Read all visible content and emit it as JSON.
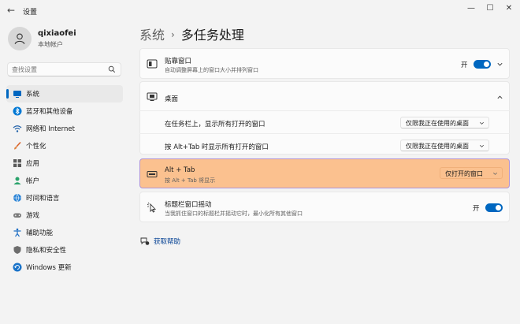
{
  "window": {
    "title": "设置",
    "back_glyph": "←",
    "min_glyph": "—",
    "max_glyph": "☐",
    "close_glyph": "✕"
  },
  "user": {
    "name": "qixiaofei",
    "account_type": "本地帐户"
  },
  "search": {
    "placeholder": "查找设置"
  },
  "sidebar": {
    "items": [
      {
        "label": "系统",
        "icon": "monitor-icon",
        "active": true
      },
      {
        "label": "蓝牙和其他设备",
        "icon": "bluetooth-icon"
      },
      {
        "label": "网络和 Internet",
        "icon": "wifi-icon"
      },
      {
        "label": "个性化",
        "icon": "brush-icon"
      },
      {
        "label": "应用",
        "icon": "apps-icon"
      },
      {
        "label": "帐户",
        "icon": "person-icon"
      },
      {
        "label": "时间和语言",
        "icon": "globe-clock-icon"
      },
      {
        "label": "游戏",
        "icon": "gamepad-icon"
      },
      {
        "label": "辅助功能",
        "icon": "accessibility-icon"
      },
      {
        "label": "隐私和安全性",
        "icon": "shield-icon"
      },
      {
        "label": "Windows 更新",
        "icon": "update-icon"
      }
    ]
  },
  "breadcrumb": {
    "parent": "系统",
    "separator": "›",
    "current": "多任务处理"
  },
  "snap": {
    "title": "贴靠窗口",
    "desc": "自动调整屏幕上的窗口大小并排列窗口",
    "state": "开"
  },
  "desktops": {
    "title": "桌面",
    "taskbar_label": "在任务栏上，显示所有打开的窗口",
    "taskbar_value": "仅限我正在使用的桌面",
    "alttab_label": "按 Alt+Tab 时显示所有打开的窗口",
    "alttab_value": "仅限我正在使用的桌面"
  },
  "alttab": {
    "title": "Alt + Tab",
    "desc": "按 Alt + Tab 将显示",
    "value": "仅打开的窗口"
  },
  "shake": {
    "title": "标题栏窗口摇动",
    "desc": "当我抓住窗口的标题栏并摇动它时，最小化所有其他窗口",
    "state": "开"
  },
  "help": {
    "label": "获取帮助"
  },
  "colors": {
    "accent": "#0067c0",
    "highlight": "#fbc18f",
    "highlight_border": "#b193d6"
  }
}
